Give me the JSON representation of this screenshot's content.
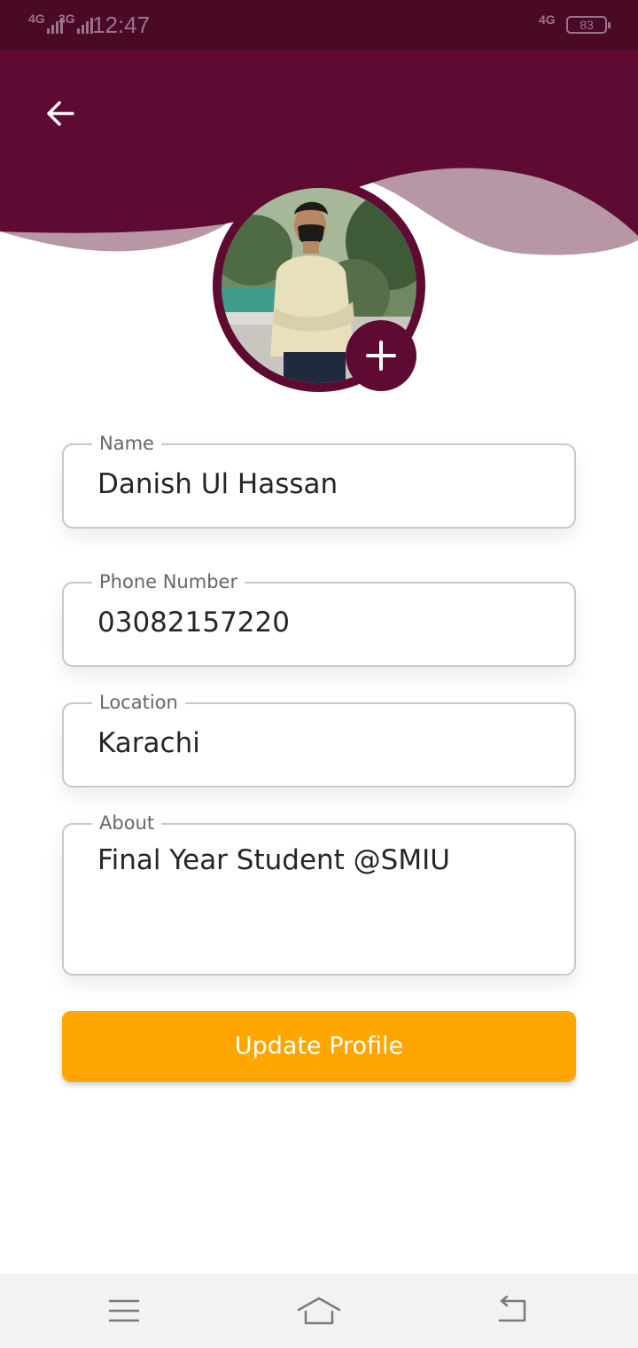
{
  "status_bar": {
    "network1": "4G",
    "network2": "3G",
    "time": "12:47",
    "network_right": "4G",
    "battery": "83"
  },
  "header": {
    "back_icon": "arrow-left-icon"
  },
  "profile": {
    "add_photo_icon": "plus-icon"
  },
  "form": {
    "name": {
      "label": "Name",
      "value": "Danish Ul Hassan"
    },
    "phone": {
      "label": "Phone Number",
      "value": "03082157220"
    },
    "location": {
      "label": "Location",
      "value": "Karachi"
    },
    "about": {
      "label": "About",
      "value": "Final Year Student @SMIU"
    }
  },
  "update_button": {
    "label": "Update Profile"
  },
  "nav_bar": {
    "icons": [
      "menu-icon",
      "home-icon",
      "back-icon"
    ]
  },
  "colors": {
    "primary": "#5e0a32",
    "status_bar": "#4a0a26",
    "wave_light": "#b797a6",
    "accent": "#ffa700"
  }
}
